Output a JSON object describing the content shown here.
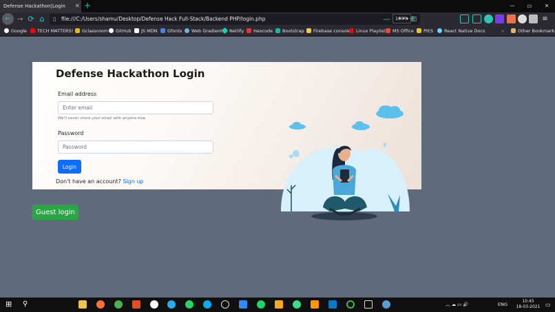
{
  "browser": {
    "tab_title": "Defense Hackathon|Login",
    "tab_close": "✕",
    "new_tab": "+",
    "url": "file:///C:/Users/shamu/Desktop/Defense Hack Full-Stack/Backend PHP/login.php",
    "zoom": "100%",
    "zoom_minus": "—",
    "zoom_plus": "+",
    "url_actions": "••• ◫ ☆",
    "window_controls": [
      "—",
      "▭",
      "✕"
    ]
  },
  "bookmarks": [
    {
      "label": "Google",
      "color": "#ffffff"
    },
    {
      "label": "TECH MATTERS!",
      "color": "#ff0000"
    },
    {
      "label": "Gclassroom",
      "color": "#f4b400"
    },
    {
      "label": "GitHub",
      "color": "#ffffff"
    },
    {
      "label": "JS MDN",
      "color": "#ffffff"
    },
    {
      "label": "Gfonts",
      "color": "#4285f4"
    },
    {
      "label": "Web Gradient",
      "color": "#6fb3e8"
    },
    {
      "label": "Netlify",
      "color": "#25c7b7"
    },
    {
      "label": "Hexcode",
      "color": "#e8333a"
    },
    {
      "label": "Bootstrap",
      "color": "#20b2aa"
    },
    {
      "label": "Firebase console",
      "color": "#ffca28"
    },
    {
      "label": "Linux Playlist",
      "color": "#ff0000"
    },
    {
      "label": "MS Office",
      "color": "#e74c3c"
    },
    {
      "label": "PIES",
      "color": "#f1c40f"
    },
    {
      "label": "React Native Docs",
      "color": "#61dafb"
    }
  ],
  "other_bookmarks": "Other Bookmarks",
  "page": {
    "title": "Defense Hackathon Login",
    "email_label": "Email address",
    "email_placeholder": "Enter email",
    "email_hint": "We'll never share your email with anyone else.",
    "password_label": "Password",
    "password_placeholder": "Password",
    "login_button": "Login",
    "signup_prompt": "Don't have an account?",
    "signup_link": "Sign up",
    "guest_button": "Guest login"
  },
  "taskbar": {
    "language": "ENG",
    "time": "10:45",
    "date": "18-03-2021",
    "tray_icons": "︿ ☁ ▭ 🔊"
  },
  "colors": {
    "page_bg": "#5f6b7d",
    "primary": "#0d6efd",
    "success": "#28a745",
    "accent_teal": "#2ec4b6"
  }
}
